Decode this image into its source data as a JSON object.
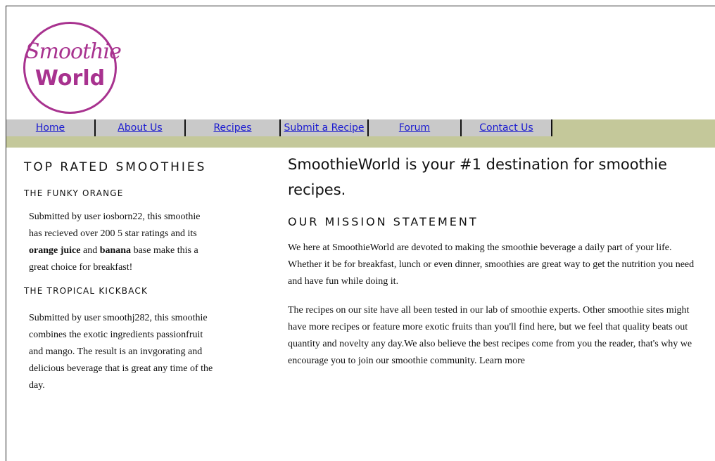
{
  "brand": {
    "logo_line1": "Smoothie",
    "logo_line2": "World",
    "color": "#a8328f"
  },
  "nav": {
    "items": [
      {
        "label": "Home"
      },
      {
        "label": "About Us"
      },
      {
        "label": "Recipes"
      },
      {
        "label": "Submit a Recipe"
      },
      {
        "label": "Forum"
      },
      {
        "label": "Contact Us"
      }
    ]
  },
  "sidebar": {
    "title": "TOP RATED SMOOTHIES",
    "smoothies": [
      {
        "name": "THE FUNKY ORANGE",
        "text_before": "Submitted by user iosborn22, this smoothie has recieved over 200 5 star ratings and its ",
        "bold1": "orange juice",
        "text_mid": " and ",
        "bold2": "banana",
        "text_after": " base make this a great choice for breakfast!"
      },
      {
        "name": "THE TROPICAL KICKBACK",
        "text": "Submitted by user smoothj282, this smoothie combines the exotic ingredients passionfruit and mango. The result is an invgorating and delicious beverage that is great any time of the day."
      }
    ]
  },
  "main": {
    "headline": "SmoothieWorld is your #1 destination for smoothie recipes.",
    "mission_title": "OUR MISSION STATEMENT",
    "paragraph1": "We here at SmoothieWorld are devoted to making the smoothie beverage a daily part of your life. Whether it be for breakfast, lunch or even dinner, smoothies are great way to get the nutrition you need and have fun while doing it.",
    "paragraph2": "The recipes on our site have all been tested in our lab of smoothie experts. Other smoothie sites might have more recipes or feature more exotic fruits than you'll find here, but we feel that quality beats out quantity and novelty any day.We also believe the best recipes come from you the reader, that's why we encourage you to join our smoothie community. Learn more"
  }
}
